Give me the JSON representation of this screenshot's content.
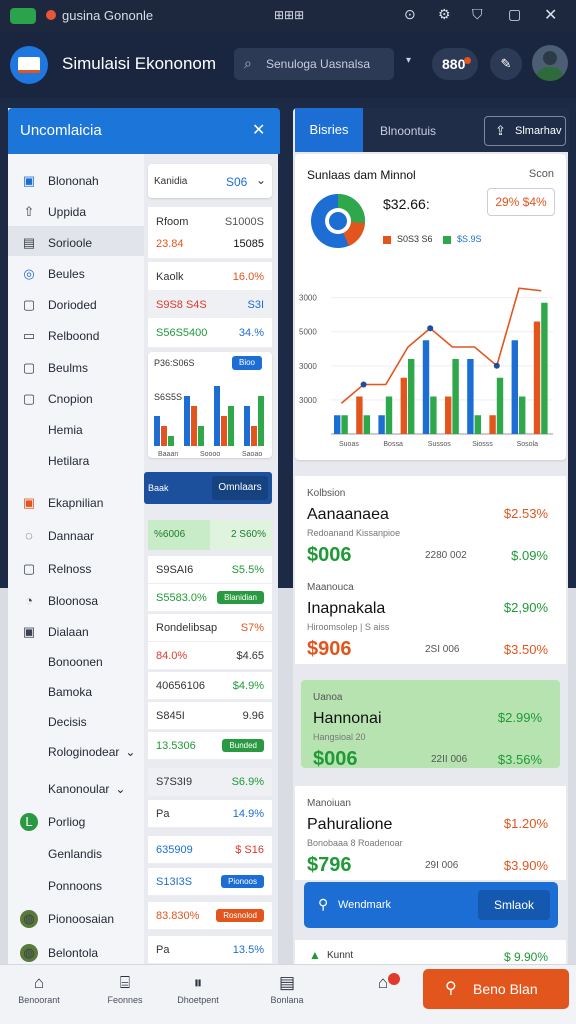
{
  "status_bar": {
    "app_label": "gusina Gononle",
    "center": "⊞⊞⊞"
  },
  "header": {
    "title": "Simulaisi Ekononom",
    "search_placeholder": "Senuloga Uasnalsa",
    "badge": "880"
  },
  "drawer": {
    "title": "Uncomlaicia",
    "items": [
      "Blononah",
      "Uppida",
      "Sorioole",
      "Beules",
      "Dorioded",
      "Relboond",
      "Beulms",
      "Cnopion",
      "Hemia",
      "Hetilara",
      "Ekapnilian",
      "Dannaar",
      "Relnoss",
      "Bloonosa",
      "Dialaan",
      "Bonoonen",
      "Bamoka",
      "Decisis",
      "Rologinodear",
      "Kanonoular",
      "Porliog",
      "Genlandis",
      "Ponnoons",
      "Pionoosaian",
      "Belontola"
    ]
  },
  "middle": {
    "select_label": "Kanidia",
    "select_value": "S06",
    "rows": [
      {
        "a": "Rfoom",
        "b": "S1000S"
      },
      {
        "a": "23.84",
        "b": "15085"
      },
      {
        "a": "Kaolk",
        "b": "16.0%"
      },
      {
        "a": "S9S8 S4S",
        "b": "S3I"
      },
      {
        "a": "S56S5400",
        "b": "34.%"
      },
      {
        "a": "P36:S06S",
        "b": "Bioo"
      },
      {
        "a": "S6S5S",
        "b": ""
      }
    ],
    "mini_ticks": [
      "Baaan",
      "Soooo",
      "Saoao"
    ],
    "banner_label": "Baak",
    "banner_button": "Omnlaars",
    "stat_left": "%6006",
    "stat_right": "2 S60%",
    "list": [
      {
        "a": "S9SAI6",
        "b": "S5.5%"
      },
      {
        "a": "S5583.0%",
        "b": "Blanidian"
      },
      {
        "a": "Rondelibsap",
        "b": "S7%"
      },
      {
        "a": "84.0%",
        "b": "$4.65"
      },
      {
        "a": "40656106",
        "b": "$4.9%"
      },
      {
        "a": "S845I",
        "b": "9.96"
      },
      {
        "a": "13.5306",
        "b": "Bunded"
      },
      {
        "a": "S7S3I9",
        "b": "S6.9%"
      },
      {
        "a": "Pa",
        "b": "14.9%"
      },
      {
        "a": "635909",
        "b": "$ S16"
      },
      {
        "a": "S13I3S",
        "b": "Pionoos"
      },
      {
        "a": "83.830%",
        "b": "Rosnolod"
      },
      {
        "a": "Pa",
        "b": "13.5%"
      }
    ]
  },
  "right": {
    "tabs": [
      "Bisries",
      "Blnoontuis"
    ],
    "share_button": "Slmarhav",
    "chart_card": {
      "title": "Sunlaas dam Minnol",
      "subtitle": "Scon",
      "total": "$32.66:",
      "badge": "29% $4%",
      "legend": [
        "S0S3 S6",
        "$S.9S"
      ],
      "y_ticks": [
        "3000",
        "3000",
        "5000",
        "3000"
      ],
      "x_ticks": [
        "Suoas",
        "Bossa",
        "Sussos",
        "Siosss",
        "Sosola"
      ]
    },
    "securities": [
      {
        "label": "Kolbsion",
        "name": "Aanaanaea",
        "detail": "Redoanand Kissanpioe",
        "value": "$006",
        "mid": "2280 002",
        "change1": "$2.53%",
        "change2": "$.09%"
      },
      {
        "label": "Maanouca",
        "name": "Inapnakala",
        "detail": "Hiroomsolep | S aiss",
        "value": "$906",
        "mid": "2SI 006",
        "change1": "$2,90%",
        "change2": "$3.50%"
      },
      {
        "label": "Uanoa",
        "name": "Hannonai",
        "detail": "Hangsioal 20",
        "value": "$006",
        "mid": "22II 006",
        "change1": "$2.99%",
        "change2": "$3.56%"
      },
      {
        "label": "Manoiuan",
        "name": "Pahuralione",
        "detail": "Bonobaaa 8 Roadenoar",
        "value": "$796",
        "mid": "29I 006",
        "change1": "$1.20%",
        "change2": "$3.90%"
      }
    ],
    "action_bar": {
      "label": "Wendmark",
      "button": "Smlaok"
    },
    "last_row": {
      "label": "Kunnt",
      "value": "$ 9.90%"
    }
  },
  "bottom_nav": {
    "items": [
      "Benoorant",
      "Feonnes",
      "Dhoetpent",
      "Bonlana",
      ""
    ],
    "cta": "Beno Blan"
  },
  "colors": {
    "primary": "#1c75d8",
    "green": "#1f9a36",
    "orange": "#e2561d",
    "red": "#e03a2c",
    "dark": "#1a2640"
  },
  "chart_data": {
    "type": "bar",
    "title": "Sunlaas dam Minnol",
    "categories": [
      "Suoas",
      "Bossa",
      "Sussos",
      "Siosss",
      "Sosola"
    ],
    "series": [
      {
        "name": "S0S3 S6",
        "values": [
          1,
          2,
          1,
          3,
          5,
          2,
          4,
          1,
          5,
          6
        ]
      },
      {
        "name": "$S.9S",
        "values": [
          1,
          1,
          2,
          4,
          2,
          4,
          1,
          3,
          2,
          7
        ]
      }
    ],
    "ylim": [
      0,
      8
    ]
  }
}
